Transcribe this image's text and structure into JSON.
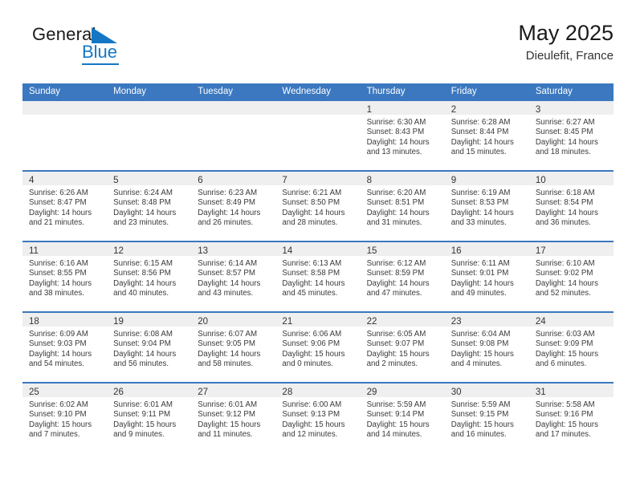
{
  "brand": {
    "name_part1": "General",
    "name_part2": "Blue",
    "triangle_icon": "blue-triangle-icon",
    "accent_color": "#1577c4"
  },
  "header": {
    "title": "May 2025",
    "subtitle": "Dieulefit, France"
  },
  "theme": {
    "header_blue": "#3b78c0",
    "band_gray": "#efefef",
    "text": "#333333"
  },
  "weekday_headers": [
    "Sunday",
    "Monday",
    "Tuesday",
    "Wednesday",
    "Thursday",
    "Friday",
    "Saturday"
  ],
  "weeks": [
    [
      {
        "day": "",
        "lines": []
      },
      {
        "day": "",
        "lines": []
      },
      {
        "day": "",
        "lines": []
      },
      {
        "day": "",
        "lines": []
      },
      {
        "day": "1",
        "lines": [
          "Sunrise: 6:30 AM",
          "Sunset: 8:43 PM",
          "Daylight: 14 hours",
          "and 13 minutes."
        ]
      },
      {
        "day": "2",
        "lines": [
          "Sunrise: 6:28 AM",
          "Sunset: 8:44 PM",
          "Daylight: 14 hours",
          "and 15 minutes."
        ]
      },
      {
        "day": "3",
        "lines": [
          "Sunrise: 6:27 AM",
          "Sunset: 8:45 PM",
          "Daylight: 14 hours",
          "and 18 minutes."
        ]
      }
    ],
    [
      {
        "day": "4",
        "lines": [
          "Sunrise: 6:26 AM",
          "Sunset: 8:47 PM",
          "Daylight: 14 hours",
          "and 21 minutes."
        ]
      },
      {
        "day": "5",
        "lines": [
          "Sunrise: 6:24 AM",
          "Sunset: 8:48 PM",
          "Daylight: 14 hours",
          "and 23 minutes."
        ]
      },
      {
        "day": "6",
        "lines": [
          "Sunrise: 6:23 AM",
          "Sunset: 8:49 PM",
          "Daylight: 14 hours",
          "and 26 minutes."
        ]
      },
      {
        "day": "7",
        "lines": [
          "Sunrise: 6:21 AM",
          "Sunset: 8:50 PM",
          "Daylight: 14 hours",
          "and 28 minutes."
        ]
      },
      {
        "day": "8",
        "lines": [
          "Sunrise: 6:20 AM",
          "Sunset: 8:51 PM",
          "Daylight: 14 hours",
          "and 31 minutes."
        ]
      },
      {
        "day": "9",
        "lines": [
          "Sunrise: 6:19 AM",
          "Sunset: 8:53 PM",
          "Daylight: 14 hours",
          "and 33 minutes."
        ]
      },
      {
        "day": "10",
        "lines": [
          "Sunrise: 6:18 AM",
          "Sunset: 8:54 PM",
          "Daylight: 14 hours",
          "and 36 minutes."
        ]
      }
    ],
    [
      {
        "day": "11",
        "lines": [
          "Sunrise: 6:16 AM",
          "Sunset: 8:55 PM",
          "Daylight: 14 hours",
          "and 38 minutes."
        ]
      },
      {
        "day": "12",
        "lines": [
          "Sunrise: 6:15 AM",
          "Sunset: 8:56 PM",
          "Daylight: 14 hours",
          "and 40 minutes."
        ]
      },
      {
        "day": "13",
        "lines": [
          "Sunrise: 6:14 AM",
          "Sunset: 8:57 PM",
          "Daylight: 14 hours",
          "and 43 minutes."
        ]
      },
      {
        "day": "14",
        "lines": [
          "Sunrise: 6:13 AM",
          "Sunset: 8:58 PM",
          "Daylight: 14 hours",
          "and 45 minutes."
        ]
      },
      {
        "day": "15",
        "lines": [
          "Sunrise: 6:12 AM",
          "Sunset: 8:59 PM",
          "Daylight: 14 hours",
          "and 47 minutes."
        ]
      },
      {
        "day": "16",
        "lines": [
          "Sunrise: 6:11 AM",
          "Sunset: 9:01 PM",
          "Daylight: 14 hours",
          "and 49 minutes."
        ]
      },
      {
        "day": "17",
        "lines": [
          "Sunrise: 6:10 AM",
          "Sunset: 9:02 PM",
          "Daylight: 14 hours",
          "and 52 minutes."
        ]
      }
    ],
    [
      {
        "day": "18",
        "lines": [
          "Sunrise: 6:09 AM",
          "Sunset: 9:03 PM",
          "Daylight: 14 hours",
          "and 54 minutes."
        ]
      },
      {
        "day": "19",
        "lines": [
          "Sunrise: 6:08 AM",
          "Sunset: 9:04 PM",
          "Daylight: 14 hours",
          "and 56 minutes."
        ]
      },
      {
        "day": "20",
        "lines": [
          "Sunrise: 6:07 AM",
          "Sunset: 9:05 PM",
          "Daylight: 14 hours",
          "and 58 minutes."
        ]
      },
      {
        "day": "21",
        "lines": [
          "Sunrise: 6:06 AM",
          "Sunset: 9:06 PM",
          "Daylight: 15 hours",
          "and 0 minutes."
        ]
      },
      {
        "day": "22",
        "lines": [
          "Sunrise: 6:05 AM",
          "Sunset: 9:07 PM",
          "Daylight: 15 hours",
          "and 2 minutes."
        ]
      },
      {
        "day": "23",
        "lines": [
          "Sunrise: 6:04 AM",
          "Sunset: 9:08 PM",
          "Daylight: 15 hours",
          "and 4 minutes."
        ]
      },
      {
        "day": "24",
        "lines": [
          "Sunrise: 6:03 AM",
          "Sunset: 9:09 PM",
          "Daylight: 15 hours",
          "and 6 minutes."
        ]
      }
    ],
    [
      {
        "day": "25",
        "lines": [
          "Sunrise: 6:02 AM",
          "Sunset: 9:10 PM",
          "Daylight: 15 hours",
          "and 7 minutes."
        ]
      },
      {
        "day": "26",
        "lines": [
          "Sunrise: 6:01 AM",
          "Sunset: 9:11 PM",
          "Daylight: 15 hours",
          "and 9 minutes."
        ]
      },
      {
        "day": "27",
        "lines": [
          "Sunrise: 6:01 AM",
          "Sunset: 9:12 PM",
          "Daylight: 15 hours",
          "and 11 minutes."
        ]
      },
      {
        "day": "28",
        "lines": [
          "Sunrise: 6:00 AM",
          "Sunset: 9:13 PM",
          "Daylight: 15 hours",
          "and 12 minutes."
        ]
      },
      {
        "day": "29",
        "lines": [
          "Sunrise: 5:59 AM",
          "Sunset: 9:14 PM",
          "Daylight: 15 hours",
          "and 14 minutes."
        ]
      },
      {
        "day": "30",
        "lines": [
          "Sunrise: 5:59 AM",
          "Sunset: 9:15 PM",
          "Daylight: 15 hours",
          "and 16 minutes."
        ]
      },
      {
        "day": "31",
        "lines": [
          "Sunrise: 5:58 AM",
          "Sunset: 9:16 PM",
          "Daylight: 15 hours",
          "and 17 minutes."
        ]
      }
    ]
  ]
}
